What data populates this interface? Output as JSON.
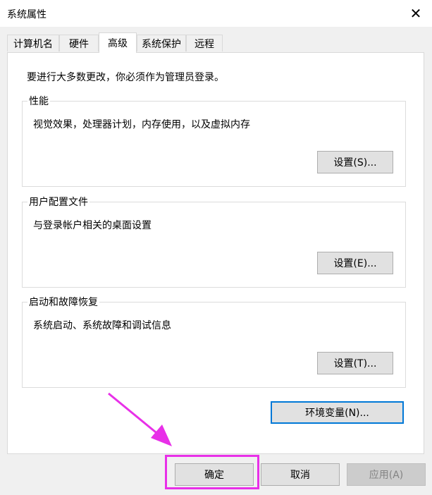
{
  "window": {
    "title": "系统属性",
    "close_icon": "close-icon"
  },
  "tabs": [
    {
      "label": "计算机名"
    },
    {
      "label": "硬件"
    },
    {
      "label": "高级"
    },
    {
      "label": "系统保护"
    },
    {
      "label": "远程"
    }
  ],
  "active_tab": "高级",
  "intro_text": "要进行大多数更改，你必须作为管理员登录。",
  "groups": {
    "performance": {
      "legend": "性能",
      "description": "视觉效果，处理器计划，内存使用，以及虚拟内存",
      "button": "设置(S)..."
    },
    "user_profiles": {
      "legend": "用户配置文件",
      "description": "与登录帐户相关的桌面设置",
      "button": "设置(E)..."
    },
    "startup_recovery": {
      "legend": "启动和故障恢复",
      "description": "系统启动、系统故障和调试信息",
      "button": "设置(T)..."
    }
  },
  "env_button": "环境变量(N)...",
  "footer": {
    "ok": "确定",
    "cancel": "取消",
    "apply": "应用(A)"
  },
  "annotation": {
    "color": "#e830e8"
  }
}
